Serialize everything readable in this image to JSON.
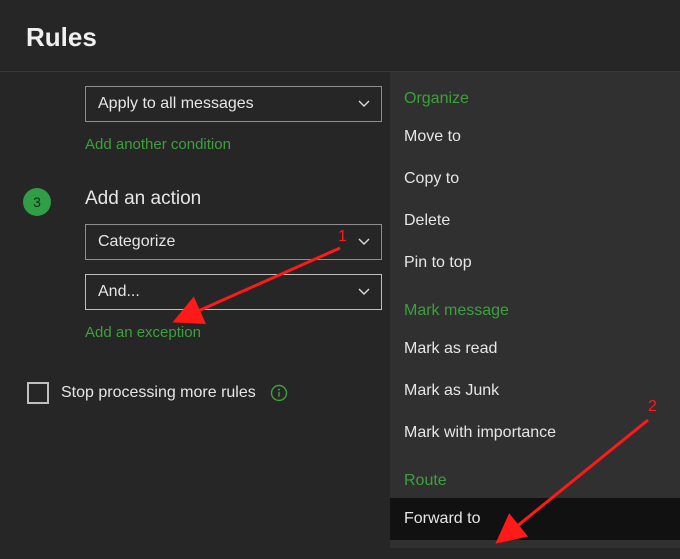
{
  "title": "Rules",
  "condition_select": {
    "label": "Apply to all messages"
  },
  "add_condition_link": "Add another condition",
  "step3": {
    "number": "3",
    "title": "Add an action"
  },
  "action_select1": {
    "label": "Categorize"
  },
  "action_select2": {
    "label": "And..."
  },
  "add_exception_link": "Add an exception",
  "stop_rules_label": "Stop processing more rules",
  "menu": {
    "groups": [
      {
        "header": "Organize",
        "items": [
          "Move to",
          "Copy to",
          "Delete",
          "Pin to top"
        ]
      },
      {
        "header": "Mark message",
        "items": [
          "Mark as read",
          "Mark as Junk",
          "Mark with importance"
        ]
      },
      {
        "header": "Route",
        "items": [
          "Forward to"
        ]
      }
    ],
    "hovered": "Forward to"
  },
  "annotations": {
    "label1": "1",
    "label2": "2"
  }
}
